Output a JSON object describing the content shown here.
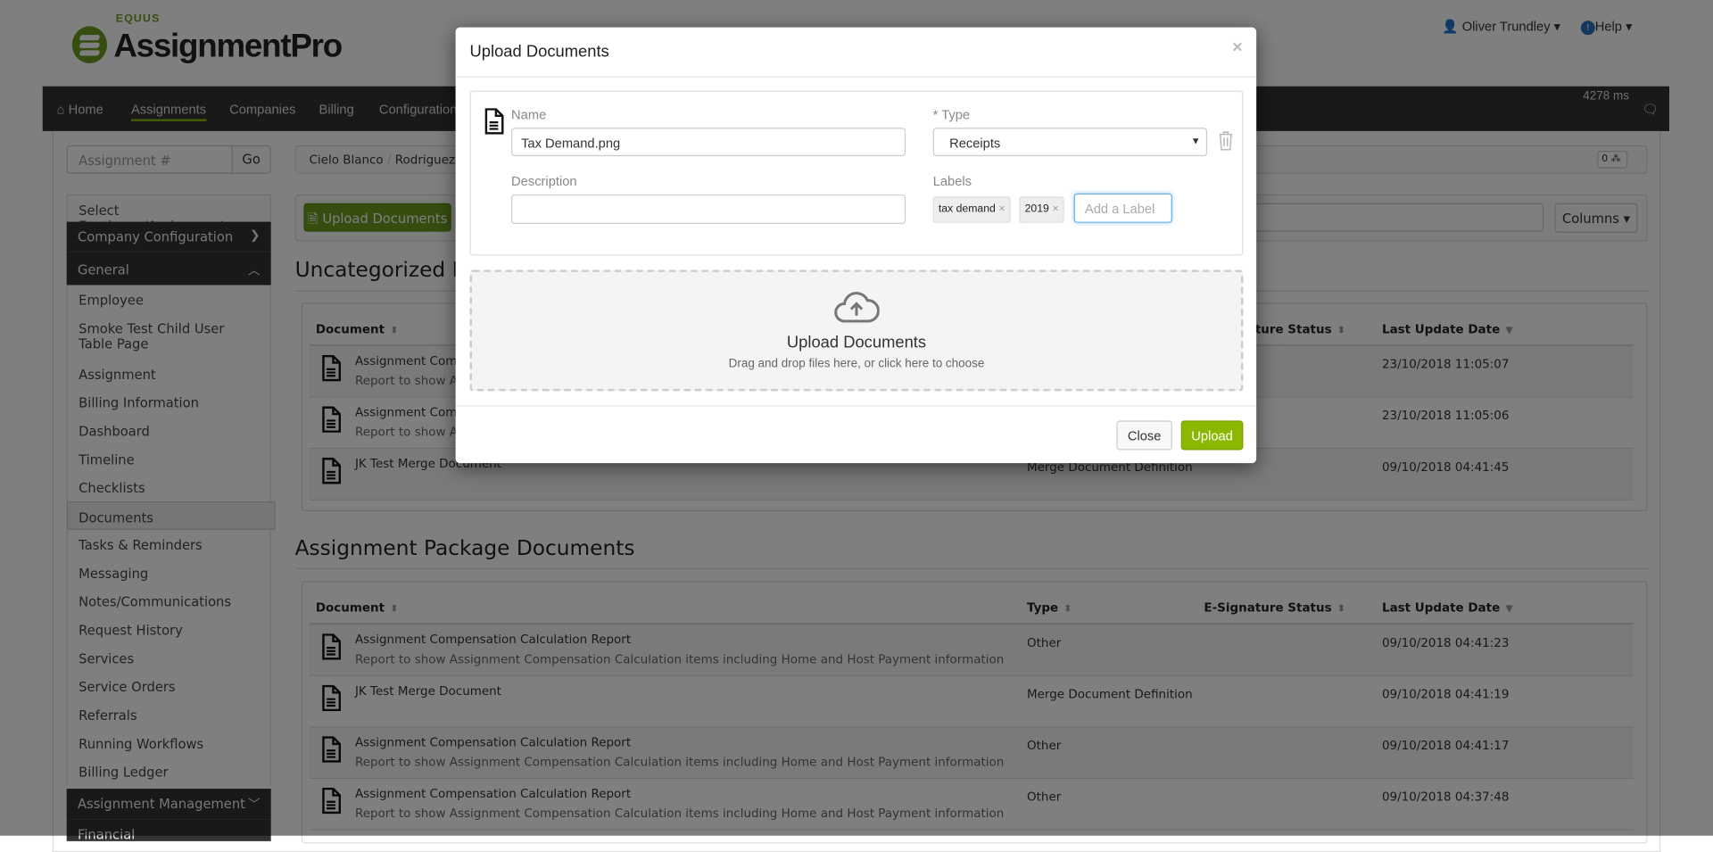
{
  "brand": {
    "small": "EQUUS",
    "name": "AssignmentPro",
    "color": "#6a9a1f"
  },
  "topmenu": {
    "user": "Oliver Trundley",
    "help": "Help"
  },
  "nav": {
    "items": [
      "Home",
      "Assignments",
      "Companies",
      "Billing",
      "Configuration"
    ],
    "active": "Assignments",
    "timing": "4278 ms"
  },
  "search": {
    "placeholder": "Assignment #",
    "go": "Go"
  },
  "breadcrumb": {
    "items": [
      "Cielo Blanco",
      "Rodriguez"
    ],
    "badge": "0"
  },
  "toolbar": {
    "upload": "Upload Documents",
    "columns": "Columns"
  },
  "sidebar": {
    "select": "Select Employee/Assignment",
    "company_config": "Company Configuration",
    "general": "General",
    "items": [
      "Employee",
      "Smoke Test Child User Table Page",
      "Assignment",
      "Billing Information",
      "Dashboard",
      "Timeline",
      "Checklists",
      "Documents",
      "Tasks & Reminders",
      "Messaging",
      "Notes/Communications",
      "Request History",
      "Services",
      "Service Orders",
      "Referrals",
      "Running Workflows",
      "Billing Ledger"
    ],
    "active": "Documents",
    "assignment_management": "Assignment Management",
    "financial": "Financial"
  },
  "tables": {
    "columns": [
      "Document",
      "Type",
      "E-Signature Status",
      "Last Update Date"
    ],
    "uncategorized": {
      "title": "Uncategorized Documents",
      "rows": [
        {
          "name": "Assignment Compensation Calculation Report",
          "desc": "Report to show Assignment Compensation Calculation items including Home and Host Payment information",
          "type": "",
          "status": "",
          "date": "23/10/2018 11:05:07"
        },
        {
          "name": "Assignment Compensation Calculation Report",
          "desc": "Report to show Assignment Compensation Calculation items including Home and Host Payment information",
          "type": "",
          "status": "",
          "date": "23/10/2018 11:05:06"
        },
        {
          "name": "JK Test Merge Document",
          "desc": "",
          "type": "Merge Document Definition",
          "status": "",
          "date": "09/10/2018 04:41:45"
        }
      ]
    },
    "package": {
      "title": "Assignment Package Documents",
      "rows": [
        {
          "name": "Assignment Compensation Calculation Report",
          "desc": "Report to show Assignment Compensation Calculation items including Home and Host Payment information",
          "type": "Other",
          "status": "",
          "date": "09/10/2018 04:41:23"
        },
        {
          "name": "JK Test Merge Document",
          "desc": "",
          "type": "Merge Document Definition",
          "status": "",
          "date": "09/10/2018 04:41:19"
        },
        {
          "name": "Assignment Compensation Calculation Report",
          "desc": "Report to show Assignment Compensation Calculation items including Home and Host Payment information",
          "type": "Other",
          "status": "",
          "date": "09/10/2018 04:41:17"
        },
        {
          "name": "Assignment Compensation Calculation Report",
          "desc": "Report to show Assignment Compensation Calculation items including Home and Host Payment information",
          "type": "Other",
          "status": "",
          "date": "09/10/2018 04:37:48"
        }
      ]
    }
  },
  "modal": {
    "title": "Upload Documents",
    "name_label": "Name",
    "name_value": "Tax Demand.png",
    "type_label": "* Type",
    "type_value": "Receipts",
    "description_label": "Description",
    "description_value": "",
    "labels_label": "Labels",
    "labels": [
      "tax demand",
      "2019"
    ],
    "label_placeholder": "Add a Label",
    "drop_title": "Upload Documents",
    "drop_hint": "Drag and drop files here, or click here to choose",
    "close": "Close",
    "upload": "Upload",
    "upload_color": "#8ab800"
  }
}
